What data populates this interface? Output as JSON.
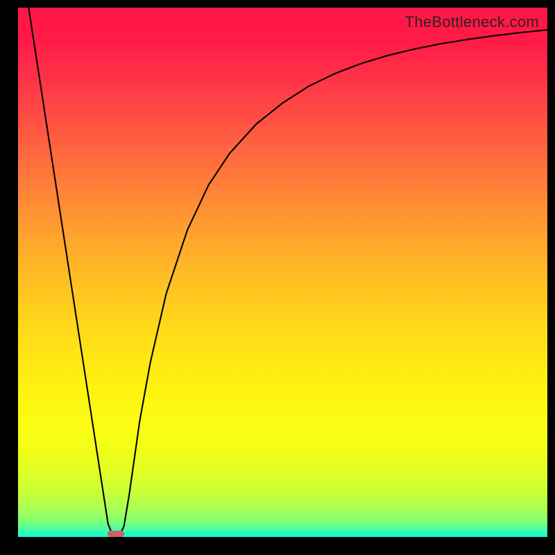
{
  "watermark": "TheBottleneck.com",
  "chart_data": {
    "type": "line",
    "title": "",
    "xlabel": "",
    "ylabel": "",
    "xlim": [
      0,
      100
    ],
    "ylim": [
      0,
      100
    ],
    "grid": false,
    "series": [
      {
        "name": "bottleneck-curve",
        "x": [
          2,
          4,
          6,
          8,
          10,
          12,
          14,
          16,
          17,
          18,
          19,
          20,
          21,
          22,
          23,
          25,
          28,
          32,
          36,
          40,
          45,
          50,
          55,
          60,
          65,
          70,
          75,
          80,
          85,
          90,
          95,
          100
        ],
        "y": [
          100,
          87,
          74,
          61,
          48,
          35,
          22,
          9,
          2.5,
          0,
          0,
          2,
          8,
          15,
          22,
          33,
          46,
          58,
          66.5,
          72.5,
          78,
          82,
          85.2,
          87.6,
          89.5,
          91,
          92.2,
          93.2,
          94,
          94.7,
          95.3,
          95.8
        ]
      }
    ],
    "marker": {
      "x_center": 18.5,
      "y": 0,
      "width_pct": 3.2,
      "height_pct": 1.2,
      "color": "#c86464"
    },
    "background_gradient": {
      "type": "vertical",
      "stops": [
        {
          "pos": 0.0,
          "color": "#ff1647"
        },
        {
          "pos": 0.5,
          "color": "#ffb82a"
        },
        {
          "pos": 0.8,
          "color": "#f8fd10"
        },
        {
          "pos": 1.0,
          "color": "#10fed7"
        }
      ]
    }
  }
}
